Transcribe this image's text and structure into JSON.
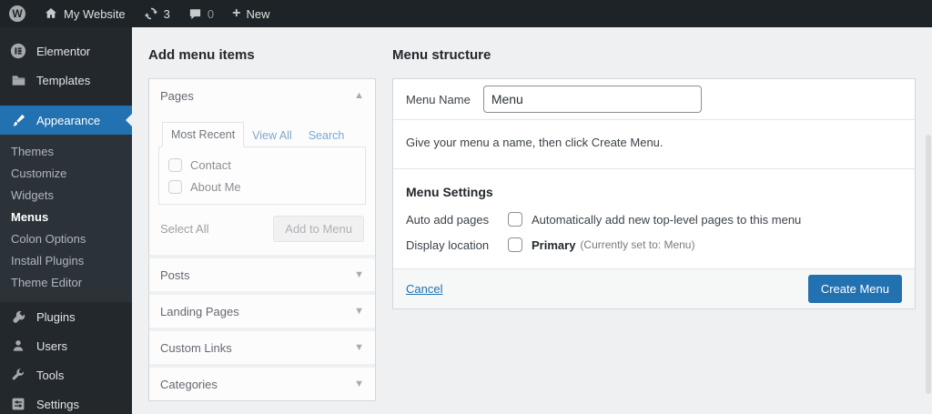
{
  "admin_bar": {
    "site_name": "My Website",
    "update_count": "3",
    "comment_count": "0",
    "new_label": "New"
  },
  "sidebar": {
    "top_items": [
      {
        "label": "Elementor"
      },
      {
        "label": "Templates"
      }
    ],
    "appearance_label": "Appearance",
    "submenu": [
      {
        "label": "Themes"
      },
      {
        "label": "Customize"
      },
      {
        "label": "Widgets"
      },
      {
        "label": "Menus"
      },
      {
        "label": "Colon Options"
      },
      {
        "label": "Install Plugins"
      },
      {
        "label": "Theme Editor"
      }
    ],
    "bottom_items": [
      {
        "label": "Plugins"
      },
      {
        "label": "Users"
      },
      {
        "label": "Tools"
      },
      {
        "label": "Settings"
      }
    ]
  },
  "left_panel": {
    "title": "Add menu items",
    "pages": {
      "label": "Pages",
      "tabs": [
        {
          "label": "Most Recent"
        },
        {
          "label": "View All"
        },
        {
          "label": "Search"
        }
      ],
      "items": [
        {
          "label": "Contact"
        },
        {
          "label": "About Me"
        }
      ],
      "select_all_label": "Select All",
      "add_to_menu_label": "Add to Menu"
    },
    "collapsed_sections": [
      {
        "label": "Posts"
      },
      {
        "label": "Landing Pages"
      },
      {
        "label": "Custom Links"
      },
      {
        "label": "Categories"
      }
    ]
  },
  "right_panel": {
    "title": "Menu structure",
    "menu_name_label": "Menu Name",
    "menu_name_value": "Menu",
    "helper_text": "Give your menu a name, then click Create Menu.",
    "settings": {
      "title": "Menu Settings",
      "auto_add_label": "Auto add pages",
      "auto_add_text": "Automatically add new top-level pages to this menu",
      "display_label": "Display location",
      "display_primary": "Primary",
      "display_note": "(Currently set to: Menu)"
    },
    "cancel_label": "Cancel",
    "create_label": "Create Menu"
  },
  "colors": {
    "accent_blue": "#2271b1",
    "admin_bar_bg": "#1d2327",
    "sidebar_bg": "#23282d",
    "submenu_bg": "#2c3338",
    "content_bg": "#eef0f1",
    "muted_link_blue": "#7ba7d2"
  }
}
